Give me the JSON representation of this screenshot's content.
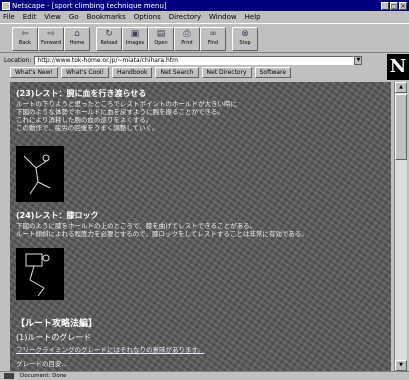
{
  "window": {
    "title": "Netscape - [sport climbing technique menu]"
  },
  "menu": [
    "File",
    "Edit",
    "View",
    "Go",
    "Bookmarks",
    "Options",
    "Directory",
    "Window",
    "Help"
  ],
  "toolbar": {
    "back": "Back",
    "forward": "Forward",
    "home": "Home",
    "reload": "Reload",
    "images": "Images",
    "open": "Open",
    "print": "Print",
    "find": "Find",
    "stop": "Stop"
  },
  "location": {
    "label": "Location:",
    "url": "http://www.tok-home.or.jp/~miata/chihara.htm"
  },
  "directory_buttons": [
    "What's New!",
    "What's Cool!",
    "Handbook",
    "Net Search",
    "Net Directory",
    "Software"
  ],
  "content": {
    "heading1": "(23)レスト：腕に血を行き渡らせる",
    "para1": [
      "ルートの下りようと思ったところでレストポイントのホールドが大きい時に",
      "下図のような体勢でホールドに血を戻すように腕を振ることができる。",
      "これにより消耗した腕の血の巡りをよくする。",
      "この動作で、疲労の回復をうまく調整していく。"
    ],
    "heading2": "(24)レスト：膝ロック",
    "para2": [
      "下図のように膝をホールドの上のところで、膝を曲げてレストできることがある。",
      "ルート傾斜によれる程度力を必要とするので、膝ロックをしてレストすることは非常に有効である。"
    ],
    "section_title": "【ルート攻略法編】",
    "heading3": "(1)ルートのグレード",
    "link_text": "フリークライミングのグレードにはそれなりの意味があります。",
    "trailing": "グレードの目安..."
  },
  "status": {
    "text": "Document: Done",
    "right": ""
  }
}
